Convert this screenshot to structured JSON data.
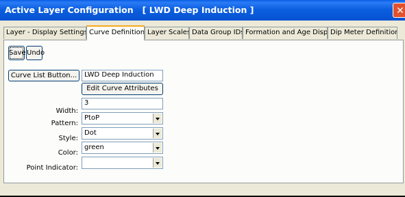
{
  "window": {
    "title": "Active Layer Configuration   [ LWD Deep Induction ]",
    "close_glyph": "✕"
  },
  "tabs": [
    {
      "label": "Layer - Display Settings",
      "active": false
    },
    {
      "label": "Curve Definitions",
      "active": true
    },
    {
      "label": "Layer Scales",
      "active": false
    },
    {
      "label": "Data Group IDs",
      "active": false
    },
    {
      "label": "Formation and Age Display",
      "active": false
    },
    {
      "label": "Dip Meter Definitions",
      "active": false
    }
  ],
  "toolbar": {
    "save_label": "Save",
    "undo_label": "Undo"
  },
  "curve": {
    "list_button_label": "Curve List Button...",
    "name_value": "LWD Deep Induction",
    "edit_attributes_label": "Edit Curve Attributes"
  },
  "fields": {
    "width_label": "Width:",
    "width_value": "3",
    "pattern_label": "Pattern:",
    "pattern_value": "PtoP",
    "style_label": "Style:",
    "style_value": "Dot",
    "color_label": "Color:",
    "color_value": "green",
    "point_indicator_label": "Point Indicator:",
    "point_indicator_value": ""
  }
}
